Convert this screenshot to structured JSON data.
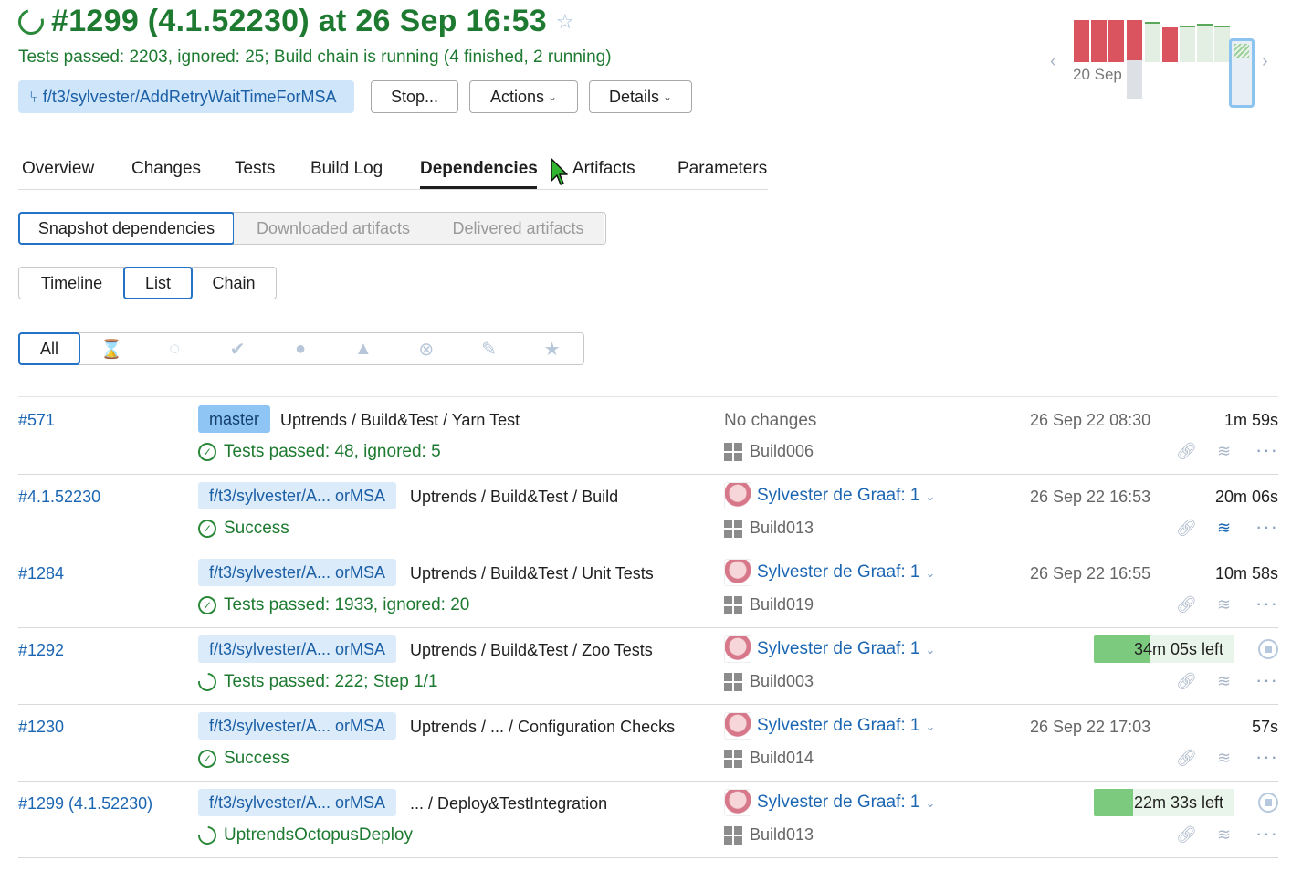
{
  "header": {
    "title": "#1299 (4.1.52230) at 26 Sep 16:53",
    "subtitle": "Tests passed: 2203, ignored: 25; Build chain is running (4 finished, 2 running)",
    "branch": "f/t3/sylvester/AddRetryWaitTimeForMSA",
    "stop_label": "Stop...",
    "actions_label": "Actions",
    "details_label": "Details"
  },
  "mini_chart": {
    "date_label": "20 Sep",
    "colors": {
      "failed": "#d9545f",
      "passed": "#e3efe3",
      "running": "#e8eef5"
    }
  },
  "tabs": [
    "Overview",
    "Changes",
    "Tests",
    "Build Log",
    "Dependencies",
    "Artifacts",
    "Parameters"
  ],
  "active_tab": "Dependencies",
  "dep_types": [
    "Snapshot dependencies",
    "Downloaded artifacts",
    "Delivered artifacts"
  ],
  "views": [
    "Timeline",
    "List",
    "Chain"
  ],
  "filter": {
    "all_label": "All",
    "icons": [
      "hourglass-icon",
      "spinner-icon",
      "check-circle-icon",
      "exclamation-circle-icon",
      "warning-triangle-icon",
      "x-circle-icon",
      "pin-icon",
      "star-icon"
    ]
  },
  "colors": {
    "accent": "#2473c7",
    "success": "#1d7a30",
    "link": "#1b66b3",
    "progress": "#7cca7e"
  },
  "rows": [
    {
      "number": "#571",
      "branch": "master",
      "path": "Uptrends / Build&Test / Yarn Test",
      "status": "Tests passed: 48, ignored: 5",
      "changes": "No changes",
      "author": "",
      "agent": "Build006",
      "date": "26 Sep 22 08:30",
      "duration": "1m 59s",
      "progress": null
    },
    {
      "number": "#4.1.52230",
      "branch": "f/t3/sylvester/A... orMSA",
      "path": "Uptrends / Build&Test / Build",
      "status": "Success",
      "changes": "",
      "author": "Sylvester de Graaf: 1",
      "agent": "Build013",
      "date": "26 Sep 22 16:53",
      "duration": "20m 06s",
      "progress": null
    },
    {
      "number": "#1284",
      "branch": "f/t3/sylvester/A... orMSA",
      "path": "Uptrends / Build&Test / Unit Tests",
      "status": "Tests passed: 1933, ignored: 20",
      "changes": "",
      "author": "Sylvester de Graaf: 1",
      "agent": "Build019",
      "date": "26 Sep 22 16:55",
      "duration": "10m 58s",
      "progress": null
    },
    {
      "number": "#1292",
      "branch": "f/t3/sylvester/A... orMSA",
      "path": "Uptrends / Build&Test / Zoo Tests",
      "status": "Tests passed: 222; Step 1/1",
      "changes": "",
      "author": "Sylvester de Graaf: 1",
      "agent": "Build003",
      "date": "",
      "duration": "",
      "progress": {
        "label": "34m 05s left",
        "fraction": 0.4
      }
    },
    {
      "number": "#1230",
      "branch": "f/t3/sylvester/A... orMSA",
      "path": "Uptrends / ... / Configuration Checks",
      "status": "Success",
      "changes": "",
      "author": "Sylvester de Graaf: 1",
      "agent": "Build014",
      "date": "26 Sep 22 17:03",
      "duration": "57s",
      "progress": null
    },
    {
      "number": "#1299 (4.1.52230)",
      "branch": "f/t3/sylvester/A... orMSA",
      "path": "... / Deploy&TestIntegration",
      "status": "UptrendsOctopusDeploy",
      "changes": "",
      "author": "Sylvester de Graaf: 1",
      "agent": "Build013",
      "date": "",
      "duration": "",
      "progress": {
        "label": "22m 33s left",
        "fraction": 0.28
      }
    }
  ]
}
